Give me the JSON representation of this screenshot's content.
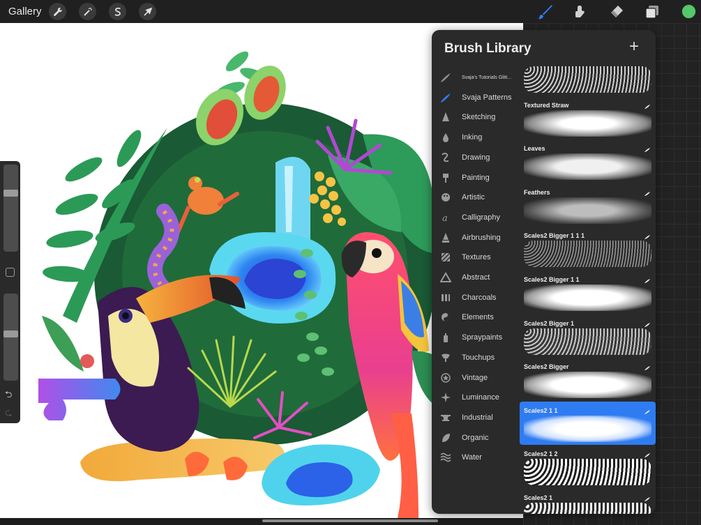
{
  "topbar": {
    "gallery_label": "Gallery",
    "left_tools": [
      "wrench-icon",
      "magic-wand-icon",
      "selection-icon",
      "transform-arrow-icon"
    ],
    "right_tools": [
      "brush-icon",
      "smudge-icon",
      "eraser-icon",
      "layers-icon"
    ],
    "active_tool_color": "#2f7cf2",
    "current_color": "#55c76b"
  },
  "library": {
    "title": "Brush Library",
    "add_label": "+",
    "sets": [
      {
        "label": "Svaja's Tutorials Glitt...",
        "icon": "stroke-icon"
      },
      {
        "label": "Svaja Patterns",
        "icon": "stroke-icon",
        "active": true
      },
      {
        "label": "Sketching",
        "icon": "pencil-tip-icon"
      },
      {
        "label": "Inking",
        "icon": "ink-drop-icon"
      },
      {
        "label": "Drawing",
        "icon": "squiggle-icon"
      },
      {
        "label": "Painting",
        "icon": "paint-brush-icon"
      },
      {
        "label": "Artistic",
        "icon": "palette-icon"
      },
      {
        "label": "Calligraphy",
        "icon": "calligraphy-icon"
      },
      {
        "label": "Airbrushing",
        "icon": "airbrush-icon"
      },
      {
        "label": "Textures",
        "icon": "textures-icon"
      },
      {
        "label": "Abstract",
        "icon": "triangle-icon"
      },
      {
        "label": "Charcoals",
        "icon": "charcoal-icon"
      },
      {
        "label": "Elements",
        "icon": "yin-yang-icon"
      },
      {
        "label": "Spraypaints",
        "icon": "spray-can-icon"
      },
      {
        "label": "Touchups",
        "icon": "touchup-icon"
      },
      {
        "label": "Vintage",
        "icon": "star-badge-icon"
      },
      {
        "label": "Luminance",
        "icon": "sparkle-icon"
      },
      {
        "label": "Industrial",
        "icon": "anvil-icon"
      },
      {
        "label": "Organic",
        "icon": "leaf-icon"
      },
      {
        "label": "Water",
        "icon": "waves-icon"
      }
    ],
    "brushes": [
      {
        "name": ""
      },
      {
        "name": "Textured Straw"
      },
      {
        "name": "Leaves"
      },
      {
        "name": "Feathers"
      },
      {
        "name": "Scales2 Bigger 1 1 1"
      },
      {
        "name": "Scales2 Bigger 1 1"
      },
      {
        "name": "Scales2 Bigger 1"
      },
      {
        "name": "Scales2 Bigger"
      },
      {
        "name": "Scales2 1 1",
        "selected": true
      },
      {
        "name": "Scales2 1 2"
      },
      {
        "name": "Scales2 1"
      }
    ]
  },
  "sidebar": {
    "undo_label": "⮌",
    "redo_label": "⮎"
  }
}
